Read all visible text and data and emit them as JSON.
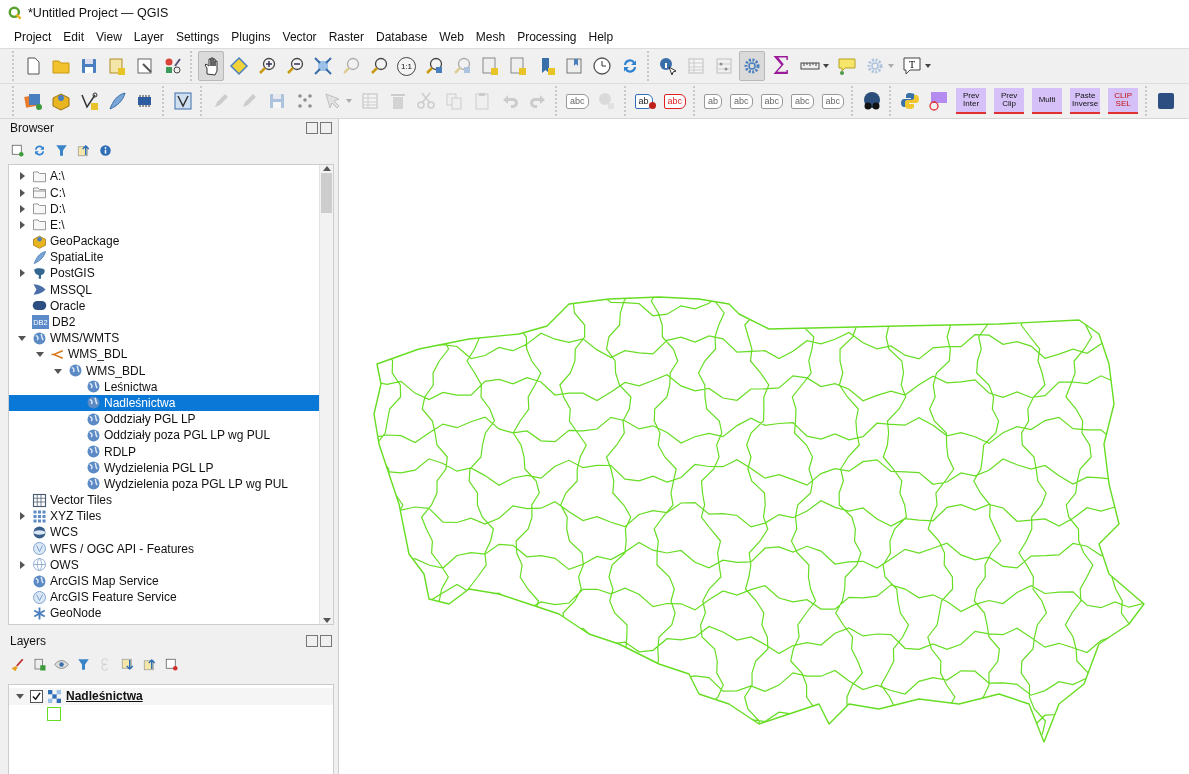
{
  "window": {
    "title": "*Untitled Project — QGIS"
  },
  "menu": [
    {
      "label": "Project"
    },
    {
      "label": "Edit"
    },
    {
      "label": "View"
    },
    {
      "label": "Layer"
    },
    {
      "label": "Settings"
    },
    {
      "label": "Plugins"
    },
    {
      "label": "Vector"
    },
    {
      "label": "Raster"
    },
    {
      "label": "Database"
    },
    {
      "label": "Web"
    },
    {
      "label": "Mesh"
    },
    {
      "label": "Processing"
    },
    {
      "label": "Help"
    }
  ],
  "toolbars": [
    [
      [
        {
          "kind": "new",
          "disabled": false,
          "pressed": false
        },
        {
          "kind": "open",
          "disabled": false,
          "pressed": false
        },
        {
          "kind": "save",
          "disabled": false,
          "pressed": false
        },
        {
          "kind": "layout",
          "disabled": false,
          "pressed": false
        },
        {
          "kind": "layout-manager",
          "disabled": false,
          "pressed": false
        },
        {
          "kind": "style",
          "disabled": false,
          "pressed": false
        }
      ],
      [
        {
          "kind": "pan",
          "disabled": false,
          "pressed": true
        },
        {
          "kind": "pan-selection",
          "disabled": false,
          "pressed": false
        },
        {
          "kind": "zoom-in",
          "disabled": false,
          "pressed": false
        },
        {
          "kind": "zoom-out",
          "disabled": false,
          "pressed": false
        },
        {
          "kind": "zoom-full",
          "disabled": false,
          "pressed": false
        },
        {
          "kind": "zoom",
          "disabled": true,
          "pressed": false
        },
        {
          "kind": "zoom",
          "disabled": false,
          "pressed": false
        },
        {
          "kind": "zoom-label",
          "label": "1:1",
          "disabled": false,
          "pressed": false
        },
        {
          "kind": "zoom-last",
          "disabled": false,
          "pressed": false
        },
        {
          "kind": "zoom-last",
          "disabled": true,
          "pressed": false
        },
        {
          "kind": "sheet",
          "disabled": false,
          "pressed": false
        },
        {
          "kind": "sheet",
          "disabled": false,
          "pressed": false
        },
        {
          "kind": "bookmark",
          "disabled": false,
          "pressed": false
        },
        {
          "kind": "book",
          "disabled": false,
          "pressed": false
        },
        {
          "kind": "clock",
          "disabled": false,
          "pressed": false
        },
        {
          "kind": "refresh",
          "disabled": false,
          "pressed": false
        }
      ],
      [
        {
          "kind": "identify",
          "disabled": false,
          "pressed": false
        },
        {
          "kind": "table",
          "disabled": true,
          "pressed": false
        },
        {
          "kind": "abacus",
          "disabled": true,
          "pressed": false
        },
        {
          "kind": "gear",
          "disabled": false,
          "pressed": true
        },
        {
          "kind": "sigma",
          "label": "Σ",
          "disabled": false,
          "pressed": false
        },
        {
          "kind": "ruler",
          "disabled": false,
          "pressed": false,
          "dropdown": true
        },
        {
          "kind": "tip",
          "disabled": false,
          "pressed": false
        },
        {
          "kind": "cog",
          "disabled": true,
          "pressed": false,
          "dropdown": true
        },
        {
          "kind": "text",
          "label": "T",
          "disabled": false,
          "pressed": false,
          "dropdown": true
        }
      ]
    ],
    [
      [
        {
          "kind": "add-layer",
          "disabled": false,
          "pressed": false
        },
        {
          "kind": "package",
          "disabled": false,
          "pressed": false
        },
        {
          "kind": "vertex",
          "disabled": false,
          "pressed": false
        },
        {
          "kind": "feather",
          "disabled": false,
          "pressed": false
        },
        {
          "kind": "chip",
          "disabled": false,
          "pressed": false
        }
      ],
      [
        {
          "kind": "vbox",
          "disabled": false,
          "pressed": false
        }
      ],
      [
        {
          "kind": "pencil",
          "disabled": true,
          "pressed": false
        },
        {
          "kind": "pencil",
          "disabled": true,
          "pressed": false
        },
        {
          "kind": "save",
          "disabled": true,
          "pressed": false
        },
        {
          "kind": "dots",
          "disabled": true,
          "pressed": false
        },
        {
          "kind": "cursor",
          "disabled": true,
          "pressed": false,
          "dropdown": true
        },
        {
          "kind": "table",
          "disabled": true,
          "pressed": false
        },
        {
          "kind": "trash",
          "disabled": true,
          "pressed": false
        },
        {
          "kind": "scissors",
          "disabled": true,
          "pressed": false
        },
        {
          "kind": "copy",
          "disabled": true,
          "pressed": false
        },
        {
          "kind": "paste",
          "disabled": true,
          "pressed": false
        },
        {
          "kind": "undo",
          "disabled": true,
          "pressed": false
        },
        {
          "kind": "redo",
          "disabled": true,
          "pressed": false
        }
      ],
      [
        {
          "kind": "tag",
          "label": "abc",
          "disabled": true,
          "pressed": false
        },
        {
          "kind": "balls",
          "disabled": true,
          "pressed": false
        }
      ],
      [
        {
          "kind": "tag-pin",
          "label": "ab",
          "disabled": false,
          "pressed": false
        },
        {
          "kind": "tag-red",
          "label": "abc",
          "disabled": false,
          "pressed": false
        }
      ],
      [
        {
          "kind": "tag",
          "label": "ab",
          "disabled": true,
          "pressed": false
        },
        {
          "kind": "tag",
          "label": "abc",
          "disabled": true,
          "pressed": false
        },
        {
          "kind": "tag",
          "label": "abc",
          "disabled": true,
          "pressed": false
        },
        {
          "kind": "tag",
          "label": "abc",
          "disabled": true,
          "pressed": false
        },
        {
          "kind": "tag",
          "label": "abc",
          "disabled": true,
          "pressed": false
        }
      ],
      [
        {
          "kind": "binoculars",
          "disabled": false,
          "pressed": false
        }
      ],
      [
        {
          "kind": "python",
          "disabled": false,
          "pressed": false
        },
        {
          "kind": "plugin",
          "disabled": false,
          "pressed": false
        },
        {
          "kind": "plugin",
          "label": "Prev Inter",
          "disabled": false,
          "pressed": false
        },
        {
          "kind": "plugin",
          "label": "Prev Clip",
          "disabled": false,
          "pressed": false
        },
        {
          "kind": "plugin",
          "label": "Multi",
          "disabled": false,
          "pressed": false
        },
        {
          "kind": "plugin",
          "label": "Paste Inverse",
          "disabled": false,
          "pressed": false
        },
        {
          "kind": "plugin-red",
          "label": "CLIP SEL",
          "disabled": false,
          "pressed": false
        }
      ],
      [
        {
          "kind": "help",
          "disabled": false,
          "pressed": false
        }
      ]
    ]
  ],
  "browser": {
    "title": "Browser",
    "tools": [
      {
        "kind": "add"
      },
      {
        "kind": "refresh"
      },
      {
        "kind": "filter"
      },
      {
        "kind": "collapse"
      },
      {
        "kind": "info"
      }
    ],
    "items": [
      {
        "label": "A:\\",
        "kind": "folder",
        "expanded": false,
        "selected": false
      },
      {
        "label": "C:\\",
        "kind": "drive",
        "expanded": false,
        "selected": false
      },
      {
        "label": "D:\\",
        "kind": "folder",
        "expanded": false,
        "selected": false
      },
      {
        "label": "E:\\",
        "kind": "folder",
        "expanded": false,
        "selected": false
      },
      {
        "label": "GeoPackage",
        "kind": "package",
        "selected": false
      },
      {
        "label": "SpatiaLite",
        "kind": "feather",
        "selected": false
      },
      {
        "label": "PostGIS",
        "kind": "elephant",
        "expanded": false,
        "selected": false
      },
      {
        "label": "MSSQL",
        "kind": "ribbon",
        "selected": false
      },
      {
        "label": "Oracle",
        "kind": "oval",
        "selected": false
      },
      {
        "label": "DB2",
        "kind": "db2",
        "icon_text": "DB2",
        "selected": false
      },
      {
        "label": "WMS/WMTS",
        "kind": "globe",
        "expanded": true,
        "selected": false,
        "children": [
          {
            "label": "WMS_BDL",
            "kind": "connection",
            "expanded": true,
            "selected": false,
            "children": [
              {
                "label": "WMS_BDL",
                "kind": "globe",
                "expanded": true,
                "selected": false,
                "children": [
                  {
                    "label": "Leśnictwa",
                    "kind": "globe",
                    "selected": false
                  },
                  {
                    "label": "Nadleśnictwa",
                    "kind": "globe",
                    "selected": true
                  },
                  {
                    "label": "Oddziały PGL LP",
                    "kind": "globe",
                    "selected": false
                  },
                  {
                    "label": "Oddziały poza PGL LP wg PUL",
                    "kind": "globe",
                    "selected": false
                  },
                  {
                    "label": "RDLP",
                    "kind": "globe",
                    "selected": false
                  },
                  {
                    "label": "Wydzielenia PGL LP",
                    "kind": "globe",
                    "selected": false
                  },
                  {
                    "label": "Wydzielenia poza PGL LP wg PUL",
                    "kind": "globe",
                    "selected": false
                  }
                ]
              }
            ]
          }
        ]
      },
      {
        "label": "Vector Tiles",
        "kind": "grid",
        "selected": false
      },
      {
        "label": "XYZ Tiles",
        "kind": "dots",
        "expanded": false,
        "selected": false
      },
      {
        "label": "WCS",
        "kind": "wcs",
        "selected": false
      },
      {
        "label": "WFS / OGC API - Features",
        "kind": "wfs",
        "selected": false
      },
      {
        "label": "OWS",
        "kind": "ows",
        "expanded": false,
        "selected": false
      },
      {
        "label": "ArcGIS Map Service",
        "kind": "globe",
        "selected": false
      },
      {
        "label": "ArcGIS Feature Service",
        "kind": "wfs",
        "selected": false
      },
      {
        "label": "GeoNode",
        "kind": "asterisk",
        "selected": false
      }
    ]
  },
  "layers": {
    "title": "Layers",
    "tools": [
      {
        "kind": "brush",
        "disabled": false
      },
      {
        "kind": "add-group",
        "disabled": false
      },
      {
        "kind": "eye",
        "disabled": false
      },
      {
        "kind": "filter",
        "disabled": false
      },
      {
        "kind": "epsilon",
        "disabled": true
      },
      {
        "kind": "expand",
        "disabled": false
      },
      {
        "kind": "collapse",
        "disabled": false
      },
      {
        "kind": "remove",
        "disabled": false
      }
    ],
    "items": [
      {
        "name": "Nadleśnictwa",
        "expanded": true,
        "checked": true,
        "selected": false,
        "color": "#66dd22"
      }
    ]
  }
}
